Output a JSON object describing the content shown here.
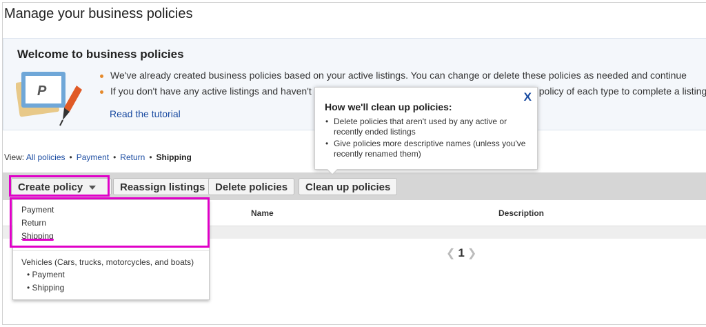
{
  "page": {
    "title": "Manage your business policies"
  },
  "welcome": {
    "title": "Welcome to business policies",
    "bullets": [
      "We've already created business policies based on your active listings. You can change or delete these policies as needed and continue",
      "If you don't have any active listings and haven't"
    ],
    "bullet2_tail": "policy of each type to complete a listing",
    "tutorial_link": "Read the tutorial",
    "illustration_icon": "paypal-card-pen-icon"
  },
  "view": {
    "label": "View:",
    "items": [
      "All policies",
      "Payment",
      "Return",
      "Shipping"
    ],
    "current": "Shipping"
  },
  "toolbar": {
    "create": "Create policy",
    "reassign": "Reassign listings",
    "delete": "Delete policies",
    "cleanup": "Clean up policies"
  },
  "table": {
    "headers": {
      "name": "Name",
      "description": "Description"
    }
  },
  "pager": {
    "page": "1",
    "prev_icon": "chevron-left-icon",
    "next_icon": "chevron-right-icon"
  },
  "create_menu": {
    "items": [
      "Payment",
      "Return",
      "Shipping"
    ],
    "vehicles_label": "Vehicles (Cars, trucks, motorcycles, and boats)",
    "vehicle_items": [
      "• Payment",
      "• Shipping"
    ]
  },
  "tooltip": {
    "title": "How we'll clean up policies:",
    "items": [
      "Delete policies that aren't used by any active or recently ended listings",
      "Give policies more descriptive names (unless you've recently renamed them)"
    ],
    "close": "X"
  },
  "colors": {
    "highlight": "#e000c8",
    "link": "#1a4ba1",
    "bullet": "#e58a2b"
  }
}
